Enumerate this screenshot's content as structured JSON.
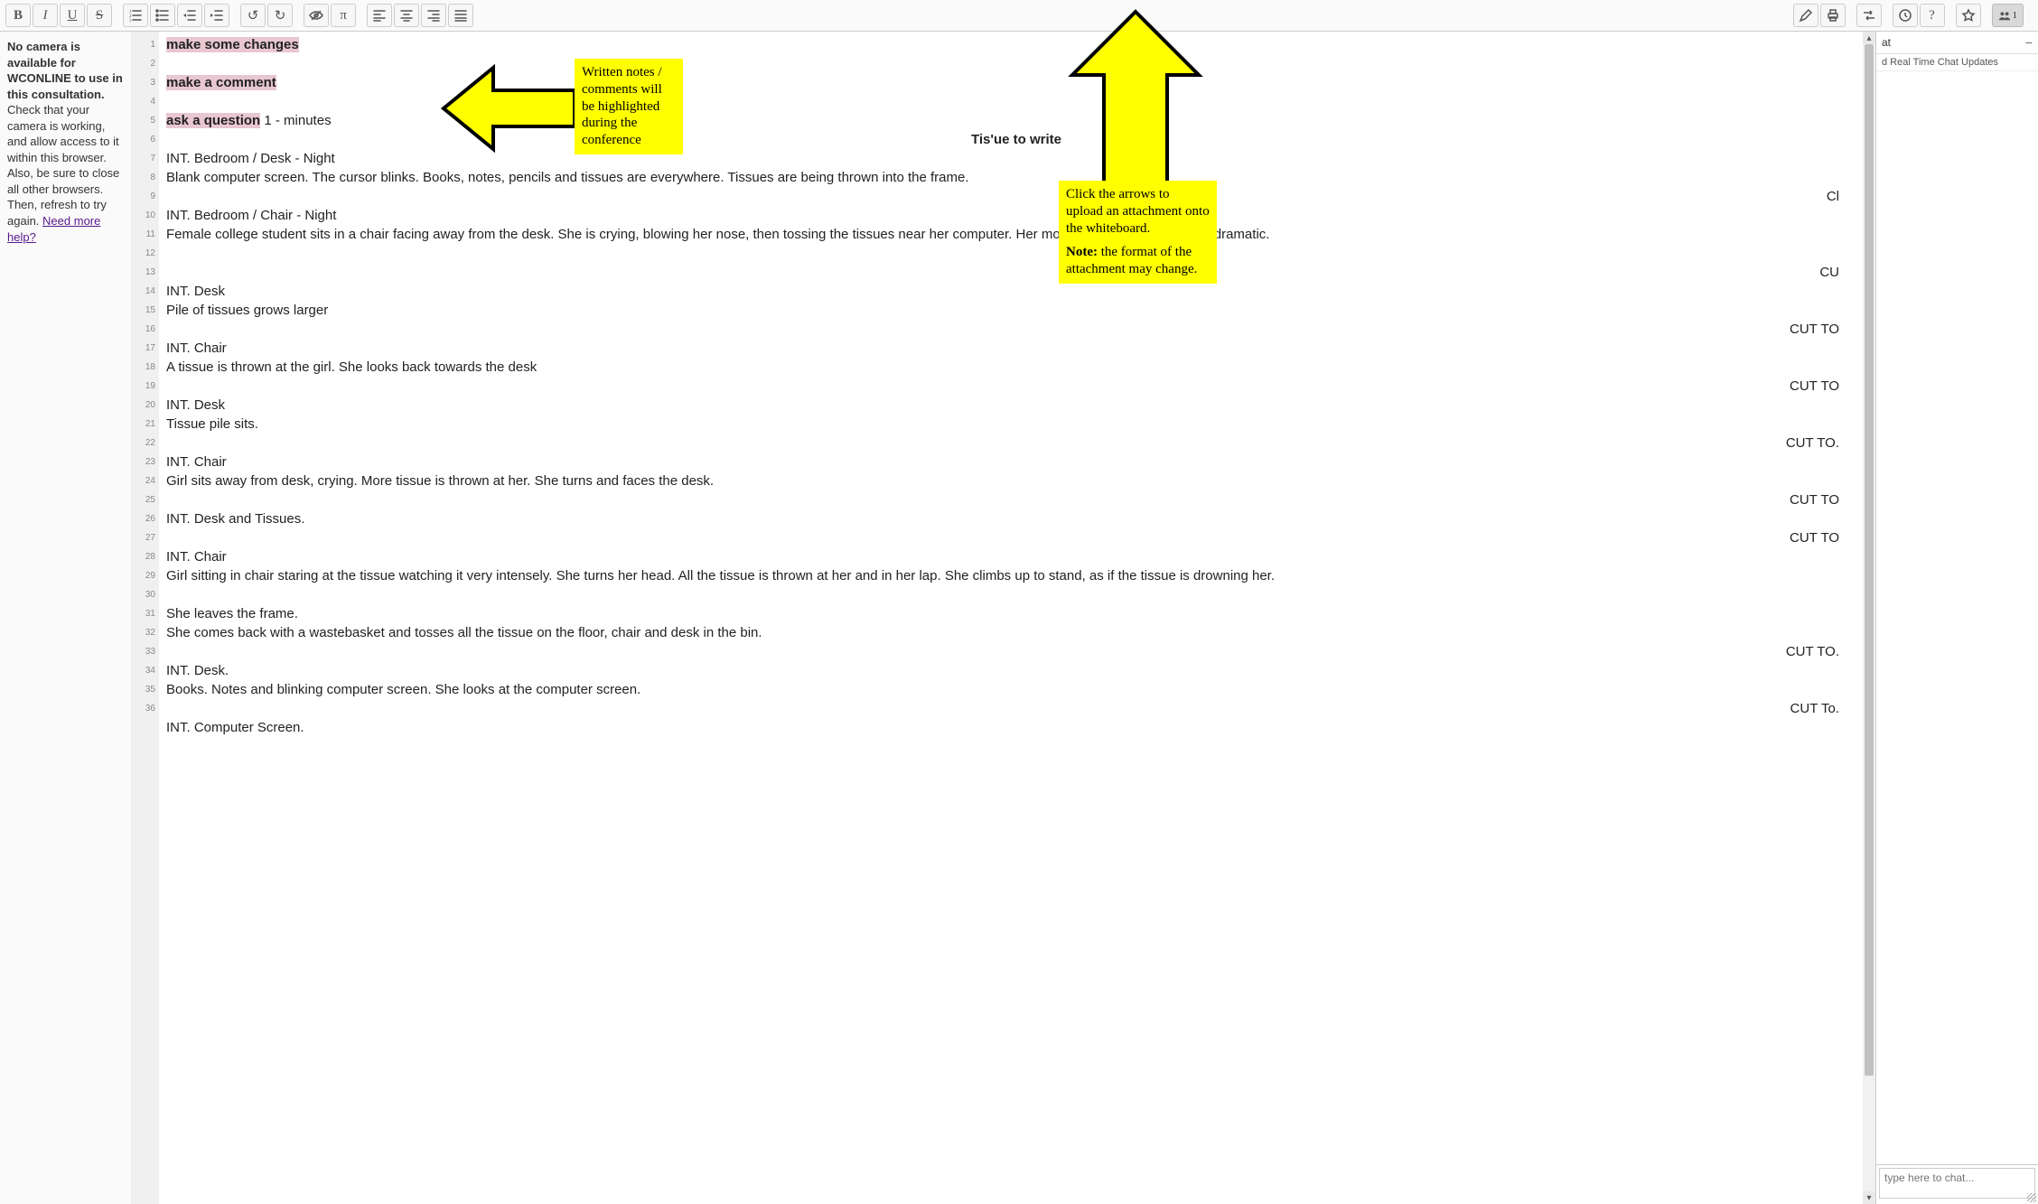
{
  "toolbar": {
    "bold": "B",
    "italic": "I",
    "underline": "U",
    "strike": "S",
    "undo": "↺",
    "redo": "↻",
    "eye": "eye-slash-icon",
    "pi": "π",
    "pencil": "pencil-icon",
    "print": "print-icon",
    "swap": "swap-icon",
    "clock": "clock-icon",
    "help": "?",
    "star": "star-icon",
    "users_count": "1"
  },
  "left_panel": {
    "bold_text": "No camera is available for WCONLINE to use in this consultation.",
    "text": " Check that your camera is working, and allow access to it within this browser. Also, be sure to close all other browsers. Then, refresh to try again. ",
    "link": "Need more help?"
  },
  "callouts": {
    "notes": "Written notes / comments will be highlighted during the conference",
    "upload_line1": "Click the arrows to upload an attachment onto the whiteboard.",
    "upload_note_label": "Note:",
    "upload_note_text": " the format of the attachment may change."
  },
  "doc": {
    "ln1": "make some changes",
    "ln3": "make a comment",
    "ln5a": "ask a question",
    "ln5b": "  1 - minutes",
    "title": "Tis'ue to write",
    "ln7": "INT. Bedroom / Desk - Night",
    "ln8": "Blank computer screen. The cursor blinks. Books, notes, pencils and tissues are everywhere. Tissues are being thrown into the frame.",
    "cut_cl": "Cl",
    "ln10": "INT. Bedroom / Chair - Night",
    "ln11": "Female college student sits in a chair facing away from the desk. She is crying, blowing her nose, then tossing the tissues near her computer. Her motion very mechanical and dramatic.",
    "cut_cu": "CU",
    "ln13": "INT. Desk",
    "ln14": "Pile of tissues grows larger",
    "cut1": "CUT TO",
    "ln16": "INT. Chair",
    "ln17": "A tissue is thrown at the girl. She looks back towards the desk",
    "cut2": "CUT TO",
    "ln19": "INT. Desk",
    "ln20": "Tissue pile sits.",
    "cut3": "CUT TO.",
    "ln22": "INT. Chair",
    "ln23": "Girl sits away from desk, crying. More tissue is thrown at her. She turns and faces the desk.",
    "cut4": "CUT TO",
    "ln25": "INT. Desk and Tissues.",
    "cut5": "CUT TO",
    "ln27": "INT. Chair",
    "ln28": "Girl sitting in chair staring at the tissue watching it very intensely. She turns her head. All the tissue is thrown at her and in her lap. She climbs up to stand, as if the tissue is drowning her.",
    "ln29": "She leaves the frame.",
    "ln30": "She comes back with a wastebasket and tosses all the tissue on the floor, chair and desk in the bin.",
    "cut6": "CUT TO.",
    "ln32": "INT. Desk.",
    "ln33": "Books. Notes and blinking computer screen. She looks at the computer screen.",
    "cut7": "CUT To.",
    "ln35": "INT. Computer Screen."
  },
  "chat": {
    "title_suffix": "at",
    "sub": "d Real Time Chat Updates",
    "placeholder": "type here to chat..."
  },
  "line_numbers": [
    "1",
    "2",
    "3",
    "4",
    "5",
    "6",
    "7",
    "8",
    "9",
    "10",
    "11",
    "12",
    "13",
    "14",
    "15",
    "16",
    "17",
    "18",
    "19",
    "20",
    "21",
    "22",
    "23",
    "24",
    "25",
    "26",
    "27",
    "28",
    "29",
    "30",
    "31",
    "32",
    "33",
    "34",
    "35",
    "36"
  ]
}
